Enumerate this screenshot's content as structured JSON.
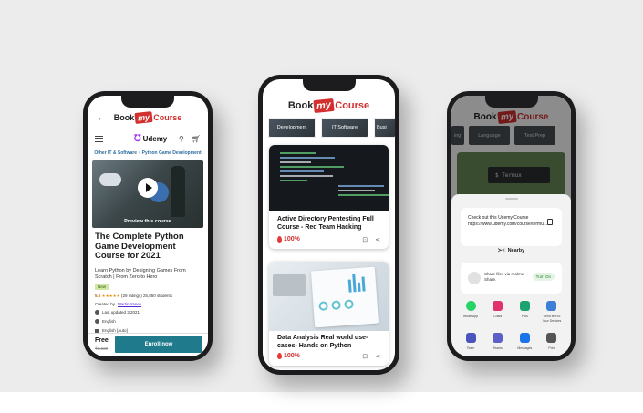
{
  "brand": {
    "pre": "Book",
    "my": "my",
    "post": "Course"
  },
  "phone1": {
    "back_icon": "arrow-left-icon",
    "provider": "Udemy",
    "breadcrumb": [
      "Other IT & Software",
      "Python Game Development"
    ],
    "preview_label": "Preview this course",
    "title": "The Complete Python Game Development Course for 2021",
    "subtitle": "Learn Python by Designing Games From Scratch | From Zero to Hero",
    "badge": "New",
    "rating_score": "5.0",
    "rating_stars": "★★★★★",
    "rating_text": "(29 ratings)",
    "students": "25,850 students",
    "created_by_label": "Created by",
    "instructor": "Martin Yanev",
    "last_updated": "Last updated 3/2021",
    "language": "English",
    "captions": "English [Auto]",
    "price": "Free",
    "old_price": "₹3,630",
    "enroll_label": "Enroll now"
  },
  "phone2": {
    "chips": [
      "Development",
      "IT Software",
      "Busi"
    ],
    "courses": [
      {
        "title": "Active Directory Pentesting Full Course - Red Team Hacking",
        "percent": "100%"
      },
      {
        "title": "Data Analysis Real world use-cases- Hands on Python",
        "percent": "100%"
      }
    ]
  },
  "phone3": {
    "chips": [
      "ing",
      "Language",
      "Test Prep"
    ],
    "terminal_text": "$ Termux",
    "share_text": "Check out this Udemy Course https://www.udemy.com/course/termu...",
    "nearby_label": "Nearby",
    "share_files_text": "Share files via realme Share.",
    "turn_on_label": "Turn On",
    "apps_row1": [
      {
        "label": "WhatsApp",
        "color": "#25d366",
        "icon": "whatsapp-icon"
      },
      {
        "label": "Chats",
        "color": "#e1306c",
        "icon": "instagram-icon"
      },
      {
        "label": "Plus",
        "color": "#1ca36f",
        "icon": "plus-messenger-icon"
      },
      {
        "label": "Send text to Your Devices",
        "color": "#3d7fd6",
        "icon": "devices-icon"
      }
    ],
    "apps_row2": [
      {
        "label": "Team",
        "color": "#4b53bc",
        "icon": "teams-icon"
      },
      {
        "label": "Teams",
        "color": "#5b5fc7",
        "icon": "teams-icon"
      },
      {
        "label": "Messages",
        "color": "#1a73e8",
        "icon": "messages-icon"
      },
      {
        "label": "Print",
        "color": "#555555",
        "icon": "print-icon"
      }
    ]
  },
  "colors": {
    "brand_red": "#d32f2f",
    "enroll_teal": "#1f7a8c",
    "udemy_purple": "#a435f0"
  }
}
